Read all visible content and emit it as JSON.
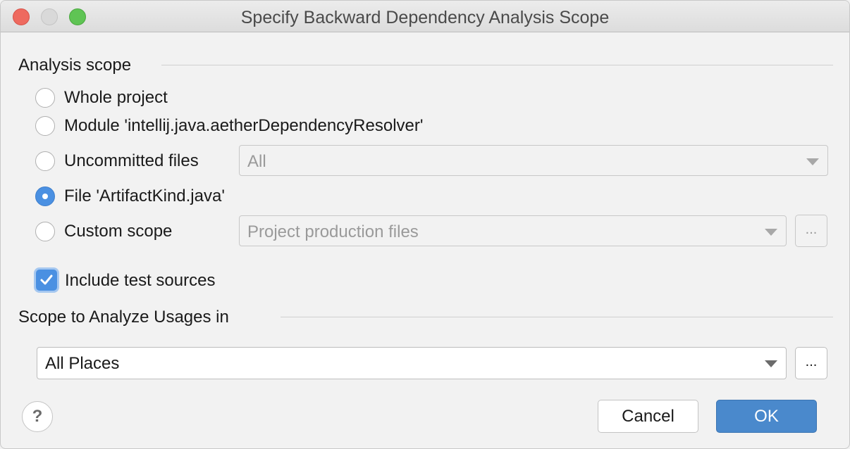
{
  "window": {
    "title": "Specify Backward Dependency Analysis Scope"
  },
  "analysis_scope": {
    "label": "Analysis scope",
    "options": [
      {
        "label": "Whole project",
        "selected": false
      },
      {
        "label": "Module 'intellij.java.aetherDependencyResolver'",
        "selected": false
      },
      {
        "label": "Uncommitted files",
        "selected": false
      },
      {
        "label": "File 'ArtifactKind.java'",
        "selected": true
      },
      {
        "label": "Custom scope",
        "selected": false
      }
    ],
    "uncommitted_combo_value": "All",
    "custom_scope_combo_value": "Project production files",
    "ellipsis_label": "...",
    "include_test_sources": {
      "label": "Include test sources",
      "checked": true
    }
  },
  "usages_scope": {
    "label": "Scope to Analyze Usages in",
    "combo_value": "All Places",
    "ellipsis_label": "..."
  },
  "footer": {
    "help_label": "?",
    "cancel_label": "Cancel",
    "ok_label": "OK"
  },
  "colors": {
    "accent": "#4a90e2",
    "ok_button": "#4a89cc"
  }
}
